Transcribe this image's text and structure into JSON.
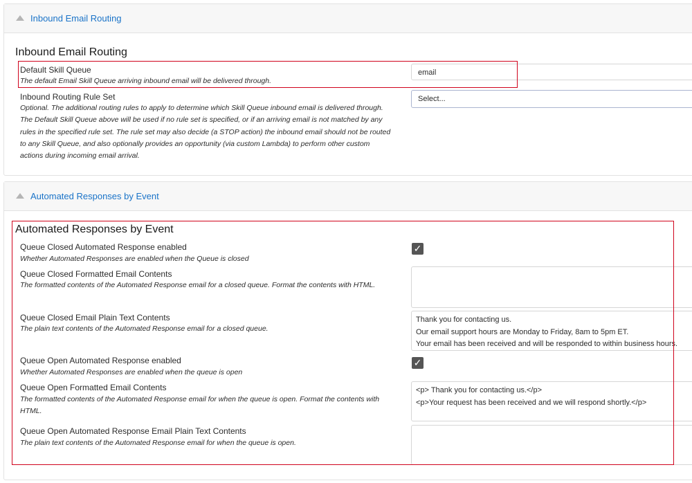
{
  "inbound_panel": {
    "header": "Inbound Email Routing",
    "section_title": "Inbound Email Routing",
    "default_queue": {
      "label": "Default Skill Queue",
      "help": "The default Email Skill Queue arriving inbound email will be delivered through.",
      "value": "email"
    },
    "rule_set": {
      "label": "Inbound Routing Rule Set",
      "help_lines": [
        "Optional. The additional routing rules to apply to determine which Skill Queue inbound email is delivered through.",
        "The Default Skill Queue above will be used if no rule set is specified, or if an arriving email is not matched by any",
        "rules in the specified rule set. The rule set may also decide (a STOP action) the inbound email should not be routed",
        "to any Skill Queue, and also optionally provides an opportunity (via custom Lambda) to perform other custom",
        "actions during incoming email arrival."
      ],
      "value": "Select..."
    }
  },
  "responses_panel": {
    "header": "Automated Responses by Event",
    "section_title": "Automated Responses by Event",
    "closed_enabled": {
      "label": "Queue Closed Automated Response enabled",
      "help": "Whether Automated Responses are enabled when the Queue is closed",
      "checked": true,
      "check_glyph": "✓"
    },
    "closed_formatted": {
      "label": "Queue Closed Formatted Email Contents",
      "help": "The formatted contents of the Automated Response email for a closed queue. Format the contents with HTML.",
      "lines": []
    },
    "closed_plain": {
      "label": "Queue Closed Email Plain Text Contents",
      "help": "The plain text contents of the Automated Response email for a closed queue.",
      "lines": [
        "Thank you for contacting us.",
        "Our email support hours are Monday to Friday, 8am to 5pm ET.",
        "Your email has been received and will be responded to within business hours."
      ]
    },
    "open_enabled": {
      "label": "Queue Open Automated Response enabled",
      "help": "Whether Automated Responses are enabled when the queue is open",
      "checked": true,
      "check_glyph": "✓"
    },
    "open_formatted": {
      "label": "Queue Open Formatted Email Contents",
      "help_lines": [
        "The formatted contents of the Automated Response email for when the queue is open. Format the contents with",
        "HTML."
      ],
      "lines": [
        "<p> Thank you for contacting us.</p>",
        "<p>Your request has been received and we will respond shortly.</p>"
      ]
    },
    "open_plain": {
      "label": "Queue Open Automated Response Email Plain Text Contents",
      "help": "The plain text contents of the Automated Response email for when the queue is open.",
      "lines": []
    }
  },
  "colors": {
    "link": "#1a73c8",
    "highlight": "#d0021b",
    "checkbox": "#555555"
  }
}
